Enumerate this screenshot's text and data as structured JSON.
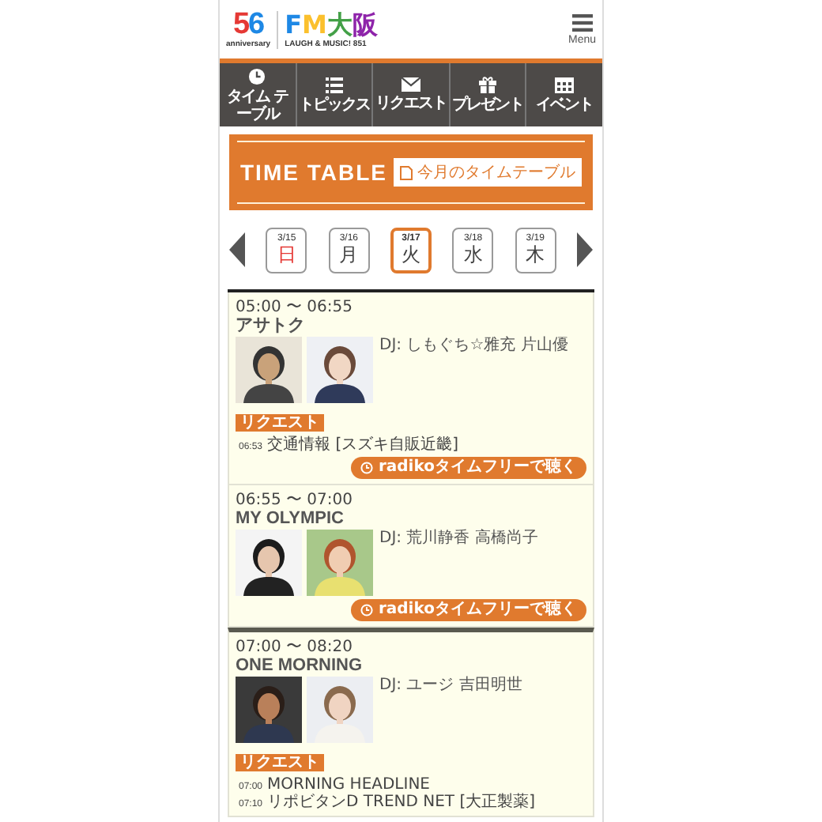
{
  "header": {
    "anniversary_logo": {
      "number": "56",
      "caption": "anniversary"
    },
    "station_logo": {
      "name": "FM大阪",
      "tagline": "LAUGH & MUSIC! 851"
    },
    "menu_label": "Menu"
  },
  "nav": [
    {
      "kind": "clock",
      "label": "タイム テーブル"
    },
    {
      "kind": "list",
      "label": "トピックス"
    },
    {
      "kind": "mail",
      "label": "リクエスト"
    },
    {
      "kind": "gift",
      "label": "プレゼント"
    },
    {
      "kind": "calendar",
      "label": "イベント"
    }
  ],
  "banner": {
    "title": "TIME TABLE",
    "link": "今月のタイムテーブル"
  },
  "days": [
    {
      "date": "3/15",
      "weekday": "日",
      "holiday": true,
      "selected": false
    },
    {
      "date": "3/16",
      "weekday": "月",
      "holiday": false,
      "selected": false
    },
    {
      "date": "3/17",
      "weekday": "火",
      "holiday": false,
      "selected": true
    },
    {
      "date": "3/18",
      "weekday": "水",
      "holiday": false,
      "selected": false
    },
    {
      "date": "3/19",
      "weekday": "木",
      "holiday": false,
      "selected": false
    }
  ],
  "programs": [
    {
      "time": "05:00 〜 06:55",
      "title": "アサトク",
      "dj": "DJ: しもぐち☆雅充 片山優",
      "photos": [
        {
          "kind": "picture"
        },
        {
          "kind": "picture"
        }
      ],
      "badge": "リクエスト",
      "segments": [
        {
          "time": "06:53",
          "text": "交通情報 [スズキ自販近畿]"
        }
      ],
      "radiko": "radikoタイムフリーで聴く"
    },
    {
      "time": "06:55 〜 07:00",
      "title": "MY OLYMPIC",
      "dj": "DJ: 荒川静香 高橋尚子",
      "photos": [
        {
          "kind": "picture"
        },
        {
          "kind": "picture"
        }
      ],
      "radiko": "radikoタイムフリーで聴く"
    },
    {
      "time": "07:00 〜 08:20",
      "title": "ONE MORNING",
      "dj": "DJ: ユージ 吉田明世",
      "photos": [
        {
          "kind": "picture"
        },
        {
          "kind": "picture"
        }
      ],
      "badge": "リクエスト",
      "segments": [
        {
          "time": "07:00",
          "text": "MORNING HEADLINE"
        },
        {
          "time": "07:10",
          "text": "リポビタンD TREND NET [大正製薬]"
        }
      ]
    }
  ]
}
